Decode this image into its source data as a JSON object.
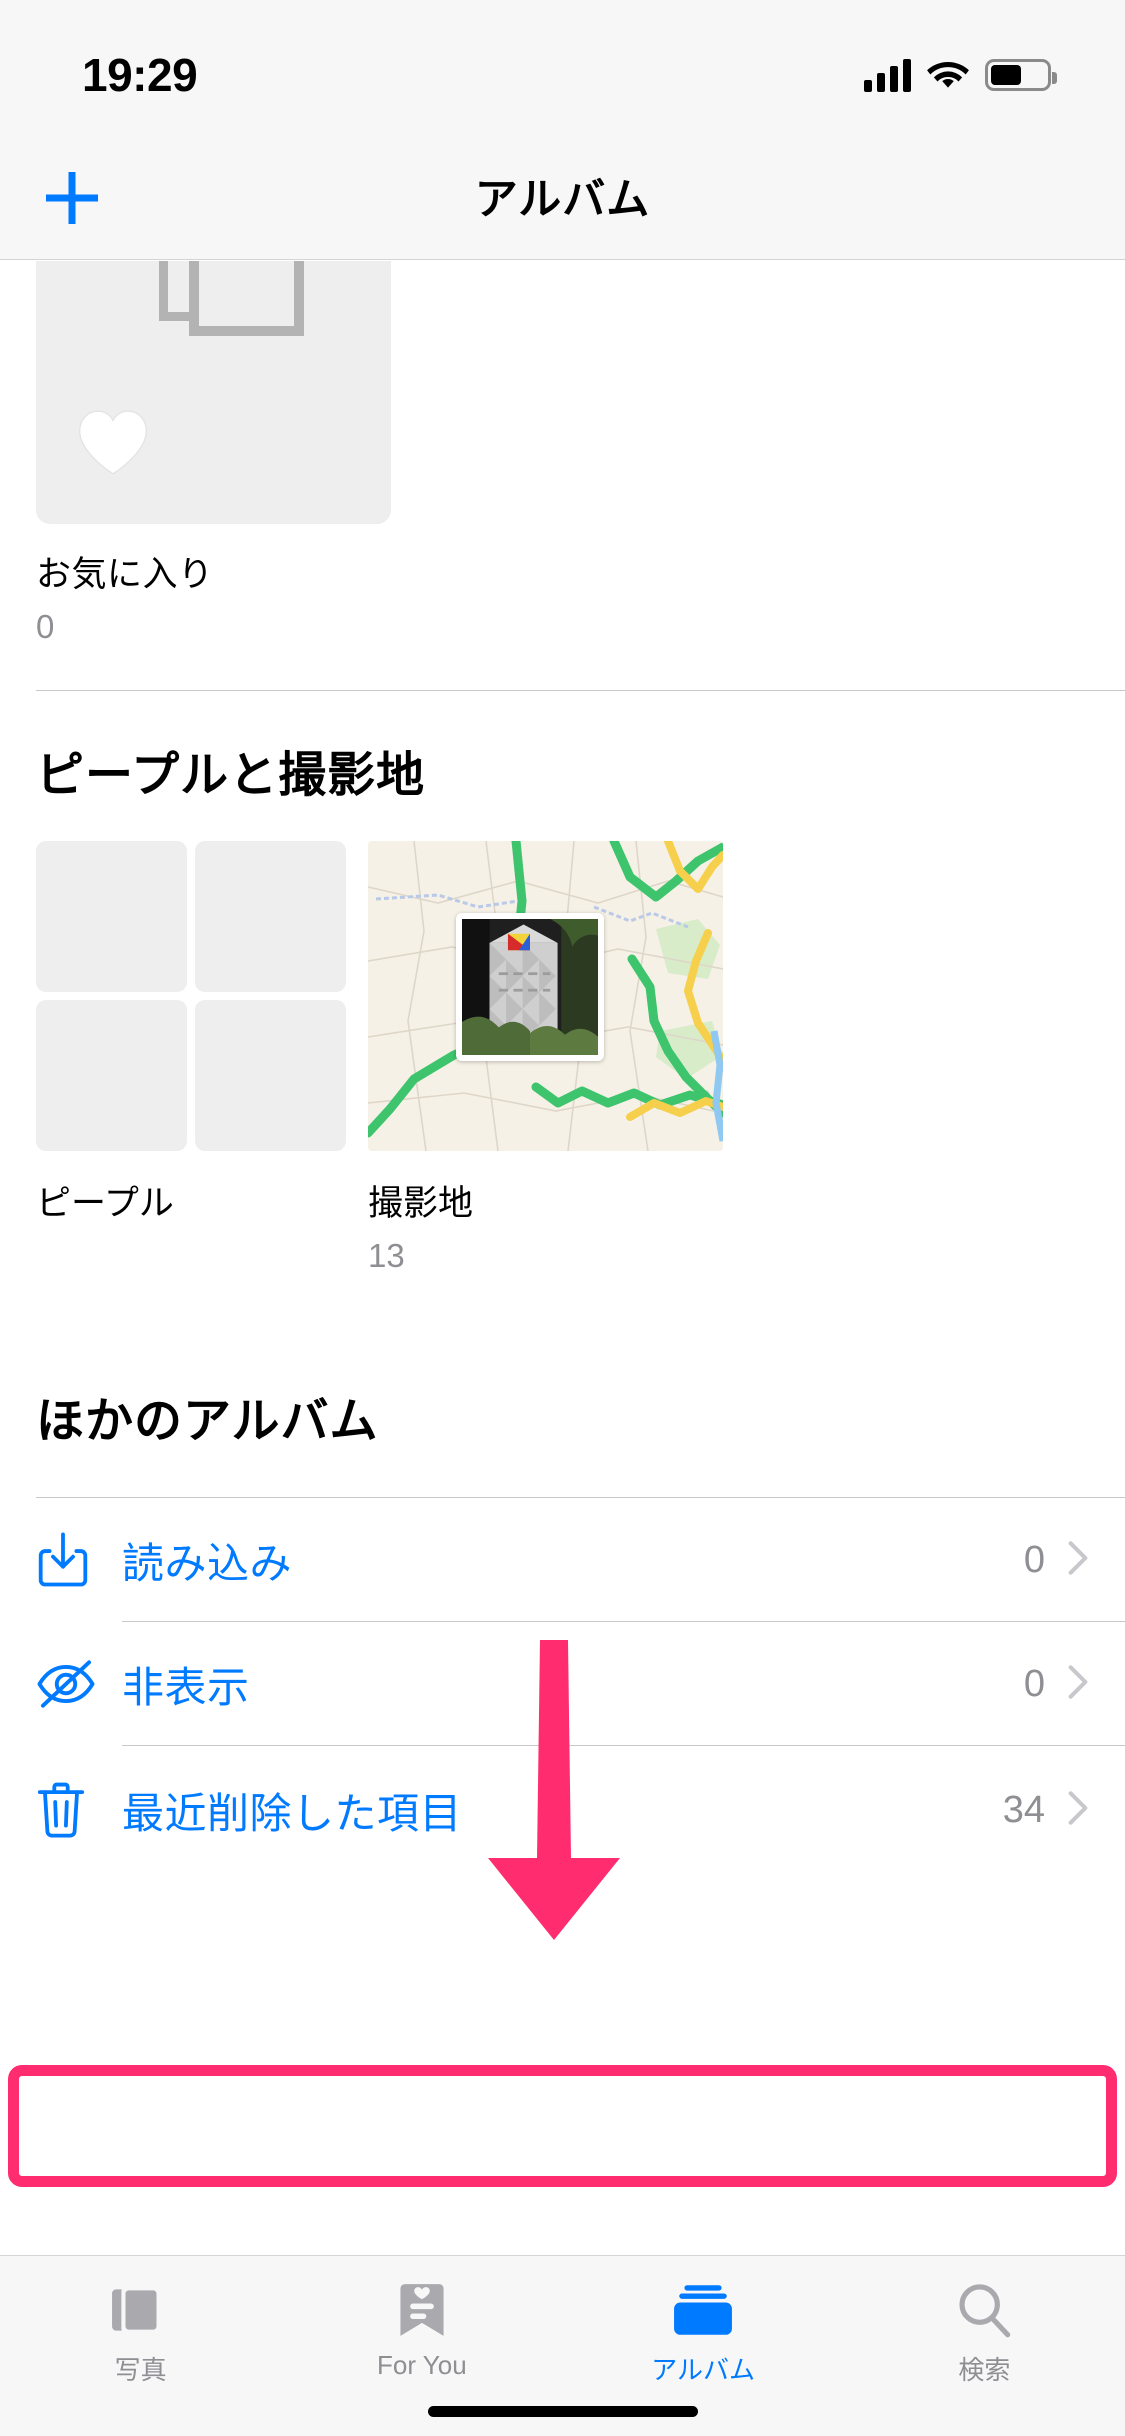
{
  "status_bar": {
    "time": "19:29",
    "signal_icon": "cellular-bars-icon",
    "wifi_icon": "wifi-icon",
    "battery_icon": "battery-icon",
    "battery_level_pct": 55
  },
  "nav": {
    "add_icon": "plus-icon",
    "title": "アルバム"
  },
  "favorites": {
    "thumbnail_icon": "photo-frames-placeholder-icon",
    "heart_icon": "heart-icon",
    "label": "お気に入り",
    "count": "0"
  },
  "people_places": {
    "section_title": "ピープルと撮影地",
    "items": [
      {
        "label": "ピープル",
        "count": "",
        "thumbnail_icon": "people-grid-placeholder-icon"
      },
      {
        "label": "撮影地",
        "count": "13",
        "thumbnail_icon": "map-thumbnail-icon"
      }
    ]
  },
  "other_albums": {
    "section_title": "ほかのアルバム",
    "rows": [
      {
        "icon": "import-icon",
        "label": "読み込み",
        "count": "0",
        "chevron": "chevron-right-icon"
      },
      {
        "icon": "eye-slash-icon",
        "label": "非表示",
        "count": "0",
        "chevron": "chevron-right-icon"
      },
      {
        "icon": "trash-icon",
        "label": "最近削除した項目",
        "count": "34",
        "chevron": "chevron-right-icon"
      }
    ],
    "highlighted_row_index": 2
  },
  "annotation": {
    "arrow_icon": "down-arrow-annotation",
    "arrow_color": "#ff2d6f",
    "highlight_color": "#ff2d6f"
  },
  "tab_bar": {
    "tabs": [
      {
        "label": "写真",
        "icon": "photos-icon",
        "active": false
      },
      {
        "label": "For You",
        "icon": "for-you-icon",
        "active": false
      },
      {
        "label": "アルバム",
        "icon": "albums-icon",
        "active": true
      },
      {
        "label": "検索",
        "icon": "search-icon",
        "active": false
      }
    ]
  },
  "colors": {
    "accent_blue": "#007aff",
    "secondary_gray": "#8e8e93",
    "bar_background": "#f7f7f7",
    "placeholder_gray": "#eeeeee",
    "annotation_pink": "#ff2d6f"
  },
  "home_indicator": "home-indicator"
}
